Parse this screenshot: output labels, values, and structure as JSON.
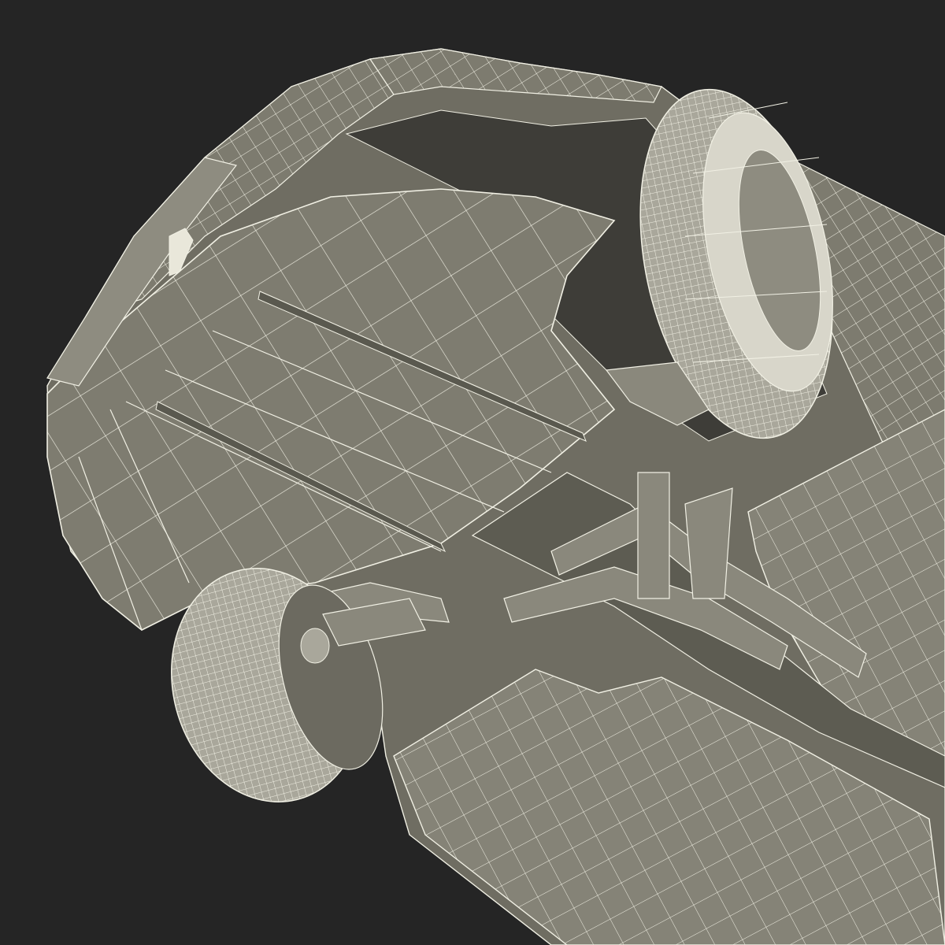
{
  "scene": {
    "subject": "car-underside-wireframe",
    "colors": {
      "background": "#252525",
      "surface": "#7d7b6f",
      "surface_light": "#8e8c80",
      "surface_dark": "#66645a",
      "shadow": "#3e3d38",
      "wire": "#f1f0e4",
      "tire": "#bcbaae"
    }
  }
}
